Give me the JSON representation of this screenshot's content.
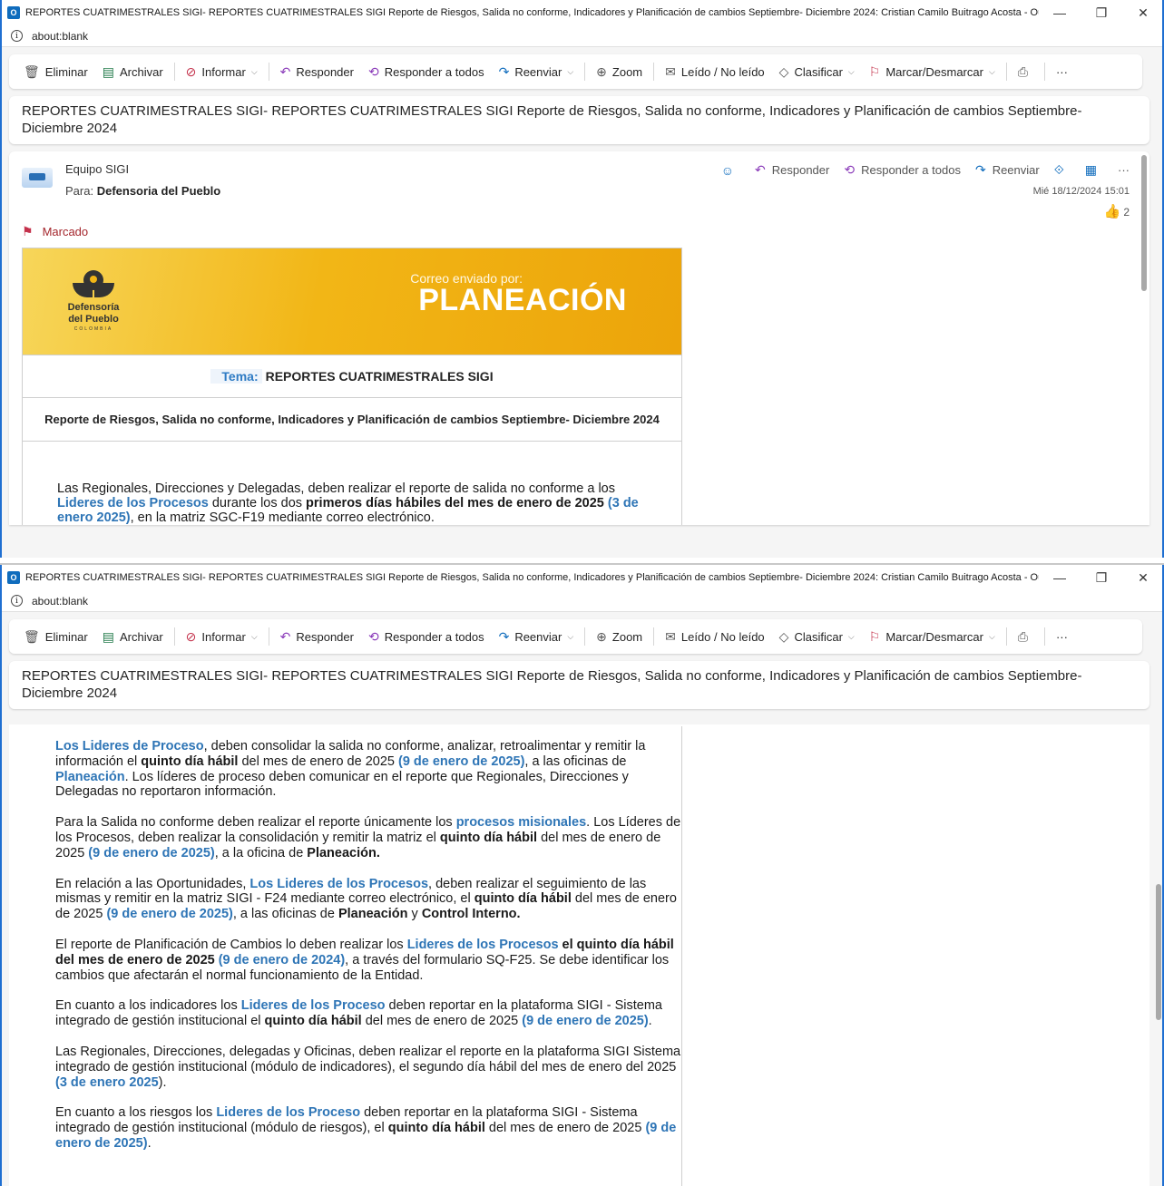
{
  "window": {
    "title": "REPORTES CUATRIMESTRALES SIGI- REPORTES CUATRIMESTRALES SIGI Reporte de Riesgos, Salida no conforme, Indicadores y Planificación de cambios Septiembre- Diciembre 2024: Cristian Camilo Buitrago Acosta - Outlook -...",
    "address": "about:blank",
    "controls": {
      "minimize": "—",
      "restore": "❐",
      "close": "✕"
    }
  },
  "toolbar": {
    "delete": "Eliminar",
    "archive": "Archivar",
    "report": "Informar",
    "reply": "Responder",
    "reply_all": "Responder a todos",
    "forward": "Reenviar",
    "zoom": "Zoom",
    "read_unread": "Leído / No leído",
    "categorize": "Clasificar",
    "flag": "Marcar/Desmarcar",
    "more": "···"
  },
  "subject": "REPORTES CUATRIMESTRALES SIGI- REPORTES CUATRIMESTRALES SIGI Reporte de Riesgos, Salida no conforme, Indicadores y Planificación de cambios Septiembre- Diciembre 2024",
  "message": {
    "sender": "Equipo SIGI",
    "to_label": "Para:",
    "to": "Defensoria del Pueblo",
    "date": "Mié 18/12/2024 15:01",
    "reaction_count": "2",
    "flag_status": "Marcado",
    "actions": {
      "reply": "Responder",
      "reply_all": "Responder a todos",
      "forward": "Reenviar",
      "more": "···"
    }
  },
  "banner": {
    "logo_line1": "Defensoría",
    "logo_line2": "del Pueblo",
    "logo_sub": "COLOMBIA",
    "sent_by": "Correo enviado por:",
    "title": "PLANEACIÓN"
  },
  "tema": {
    "label": "Tema:",
    "value": "REPORTES CUATRIMESTRALES SIGI"
  },
  "report_subtitle": "Reporte de Riesgos, Salida no conforme, Indicadores y Planificación de cambios Septiembre- Diciembre 2024",
  "body": {
    "p0": {
      "a": "Las Regionales, Direcciones y Delegadas, deben realizar el reporte de salida no conforme a los",
      "b": "Lideres de los Procesos",
      "c": " durante los ",
      "d": "dos",
      "e": " primeros días hábiles del mes de enero de 2025",
      "f": " (3 de enero 2025)",
      "g": ", en la matriz SGC-F19 mediante correo electrónico."
    },
    "p1": {
      "a": "Los Lideres de Proceso",
      "b": ", deben consolidar la salida no conforme, analizar, retroalimentar y remitir la información el ",
      "c": "quinto día hábil",
      "d": " del mes de enero de 2025 ",
      "e": "(9 de enero de 2025)",
      "f": ", a las oficinas de ",
      "g": "Planeación",
      "h": ". Los líderes de proceso deben comunicar en el reporte que Regionales, Direcciones y Delegadas no reportaron información."
    },
    "p2": {
      "a": "Para la Salida no conforme deben realizar el reporte únicamente los ",
      "b": "procesos misionales",
      "c": ". Los Líderes de los Procesos, deben realizar la consolidación y remitir la matriz el ",
      "d": "quinto día hábil",
      "e": " del mes de enero de 2025 ",
      "f": "(9 de enero de 2025)",
      "g": ", a la oficina de ",
      "h": "Planeación."
    },
    "p3": {
      "a": "En relación a las Oportunidades, ",
      "b": "Los Lideres de los Procesos",
      "c": ", deben realizar el seguimiento de las mismas y remitir en la matriz SIGI - F24 mediante correo electrónico, el ",
      "d": "quinto día hábil",
      "e": " del mes de enero de 2025 ",
      "f": "(9 de enero de 2025)",
      "g": ", a las oficinas de ",
      "h": "Planeación",
      "i": " y ",
      "j": "Control Interno."
    },
    "p4": {
      "a": "El reporte de Planificación de Cambios lo deben realizar los ",
      "b": "Lideres de los Procesos",
      "c": " el quinto día hábil del mes de enero de 2025",
      "d": " (9 de enero de 2024)",
      "e": ", a través del formulario SQ-F25. Se debe identificar los cambios que afectarán el normal funcionamiento de la Entidad."
    },
    "p5": {
      "a": "En cuanto a los indicadores los ",
      "b": "Lideres de los Proceso",
      "c": " deben reportar en la plataforma SIGI - Sistema integrado de gestión institucional el ",
      "d": "quinto día hábil",
      "e": " del mes de enero de 2025 ",
      "f": "(9 de enero de 2025)",
      "g": "."
    },
    "p6": {
      "a": "Las Regionales, Direcciones, delegadas y Oficinas, deben realizar el reporte en la plataforma SIGI Sistema integrado de gestión institucional (módulo de indicadores), el segundo día hábil del mes de enero del 2025 ",
      "b": "(3 de enero 2025",
      "c": ")."
    },
    "p7": {
      "a": "En cuanto a los riesgos los ",
      "b": "Lideres de los Proceso",
      "c": " deben reportar en la plataforma SIGI - Sistema integrado de gestión institucional (módulo de riesgos), el ",
      "d": "quinto día hábil",
      "e": " del mes de enero de 2025 ",
      "f": "(9 de enero de 2025)",
      "g": "."
    }
  },
  "colors": {
    "accent": "#0f6cbd",
    "link": "#2e75b6",
    "flag": "#c4314b",
    "banner": "#f2b616"
  }
}
